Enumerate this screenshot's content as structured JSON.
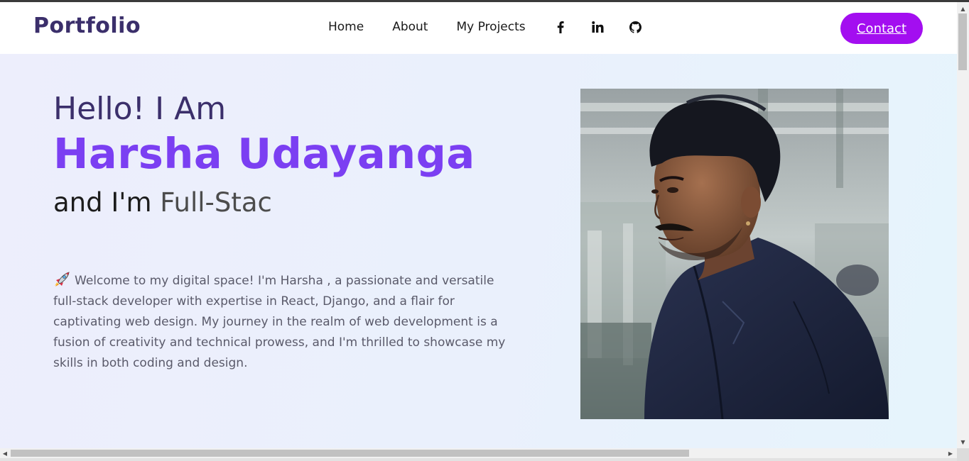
{
  "navbar": {
    "brand": "Portfolio",
    "links": [
      "Home",
      "About",
      "My Projects"
    ],
    "social_icons": [
      "facebook-icon",
      "linkedin-icon",
      "github-icon"
    ],
    "contact_label": "Contact"
  },
  "hero": {
    "greeting": "Hello! I Am",
    "name": "Harsha Udayanga",
    "role_prefix": "and I'm",
    "role_typed": "Full-Stac",
    "intro_icon": "rocket-icon",
    "intro": "Welcome to my digital space! I'm Harsha , a passionate and versatile full-stack developer with expertise in React, Django, and a flair for captivating web design. My journey in the realm of web development is a fusion of creativity and technical prowess, and I'm thrilled to showcase my skills in both coding and design."
  },
  "colors": {
    "brand": "#3b2f6b",
    "accent_name": "#7b3ff2",
    "contact_button": "#a30ef0",
    "hero_background_start": "#edeefc",
    "hero_background_end": "#e6f4fc"
  }
}
